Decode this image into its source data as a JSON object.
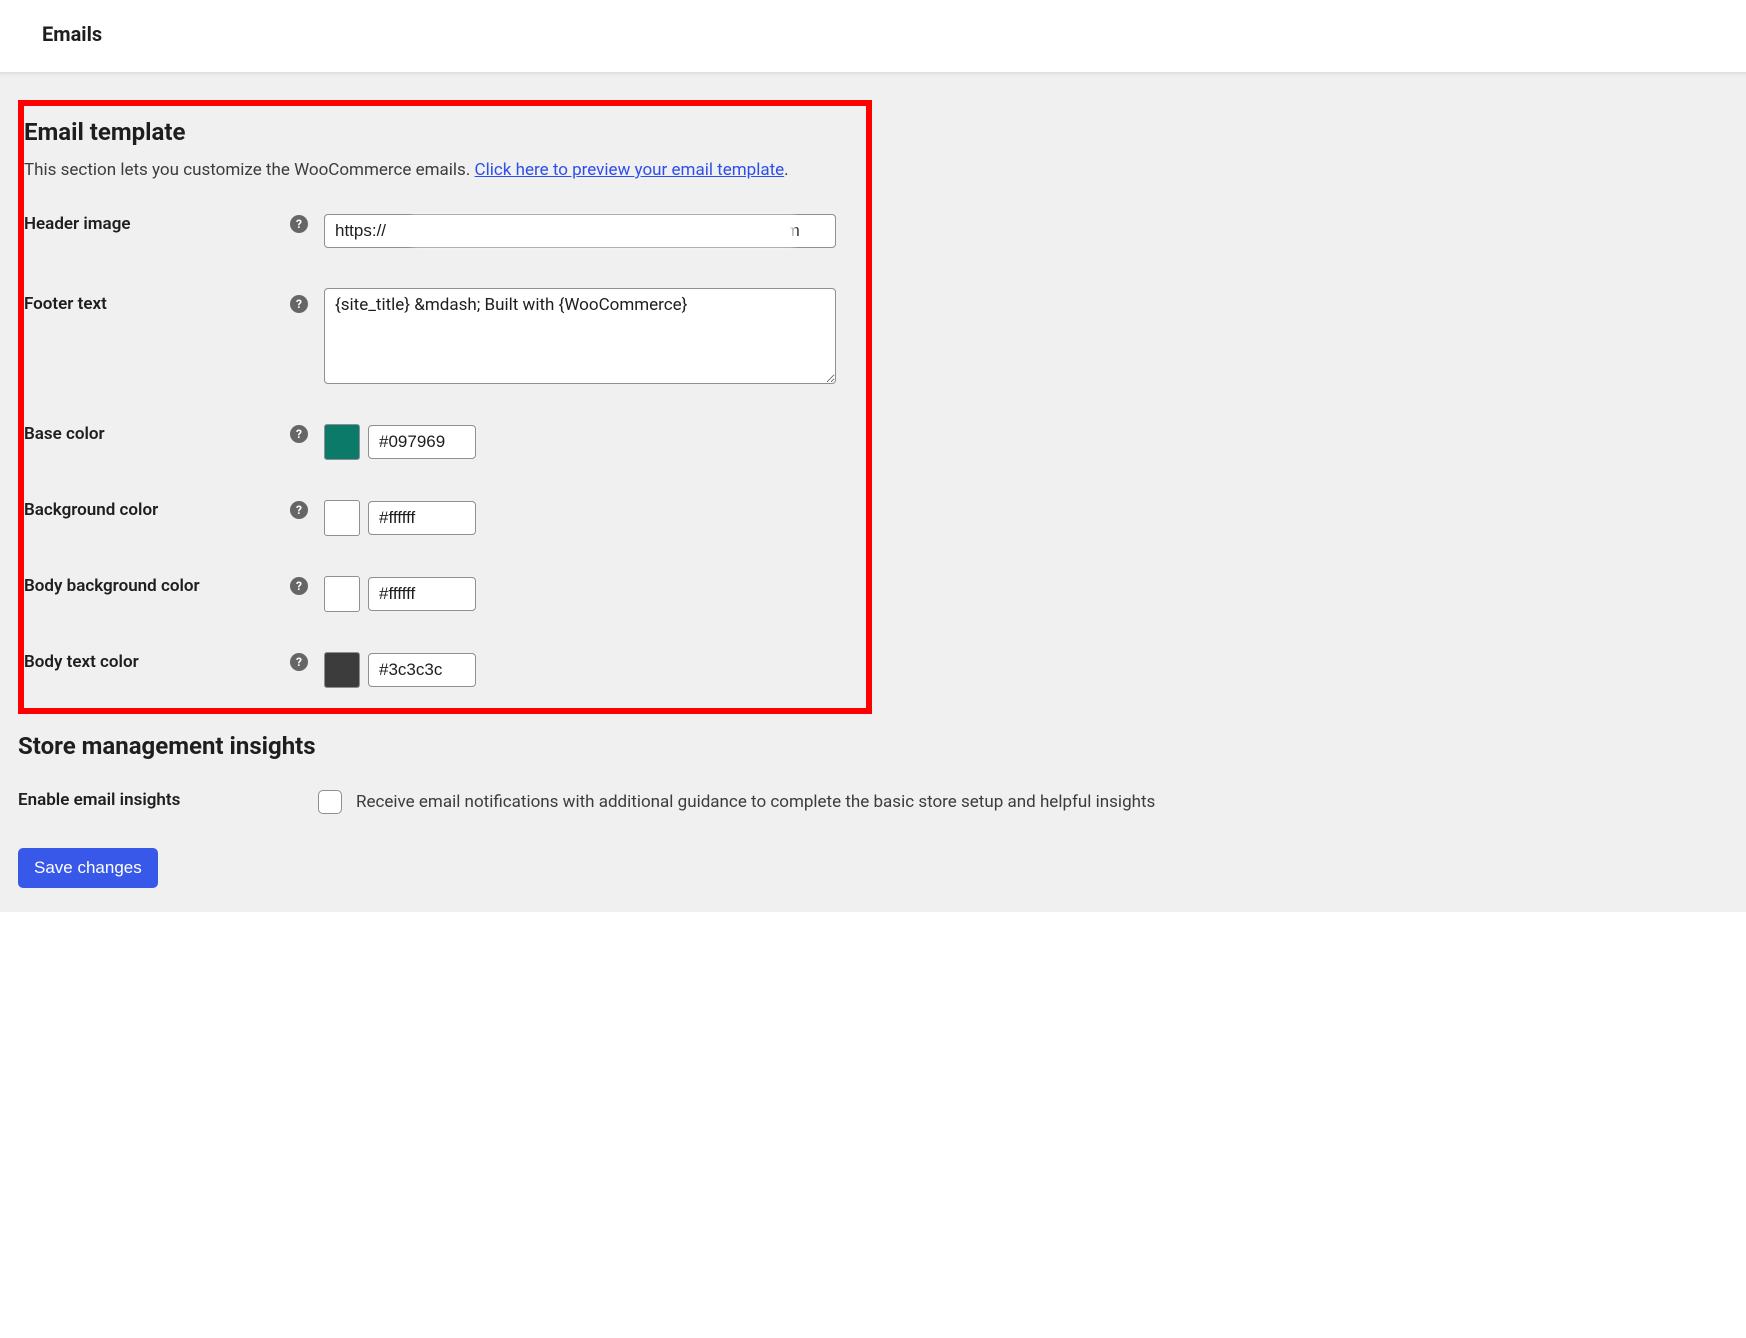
{
  "tabs": {
    "emails_label": "Emails"
  },
  "email_template": {
    "title": "Email template",
    "description_prefix": "This section lets you customize the WooCommerce emails. ",
    "preview_link_text": "Click here to preview your email template",
    "description_suffix": ".",
    "header_image": {
      "label": "Header image",
      "value": "https://                                                                          pps.com"
    },
    "footer_text": {
      "label": "Footer text",
      "value": "{site_title} &mdash; Built with {WooCommerce}"
    },
    "base_color": {
      "label": "Base color",
      "value": "#097969",
      "swatch": "#0b7a69"
    },
    "background_color": {
      "label": "Background color",
      "value": "#ffffff",
      "swatch": "#ffffff"
    },
    "body_bg_color": {
      "label": "Body background color",
      "value": "#ffffff",
      "swatch": "#ffffff"
    },
    "body_text_color": {
      "label": "Body text color",
      "value": "#3c3c3c",
      "swatch": "#3c3c3c"
    }
  },
  "store_insights": {
    "title": "Store management insights",
    "enable_label": "Enable email insights",
    "checkbox_desc": "Receive email notifications with additional guidance to complete the basic store setup and helpful insights"
  },
  "save_button": "Save changes",
  "help_icon_glyph": "?"
}
